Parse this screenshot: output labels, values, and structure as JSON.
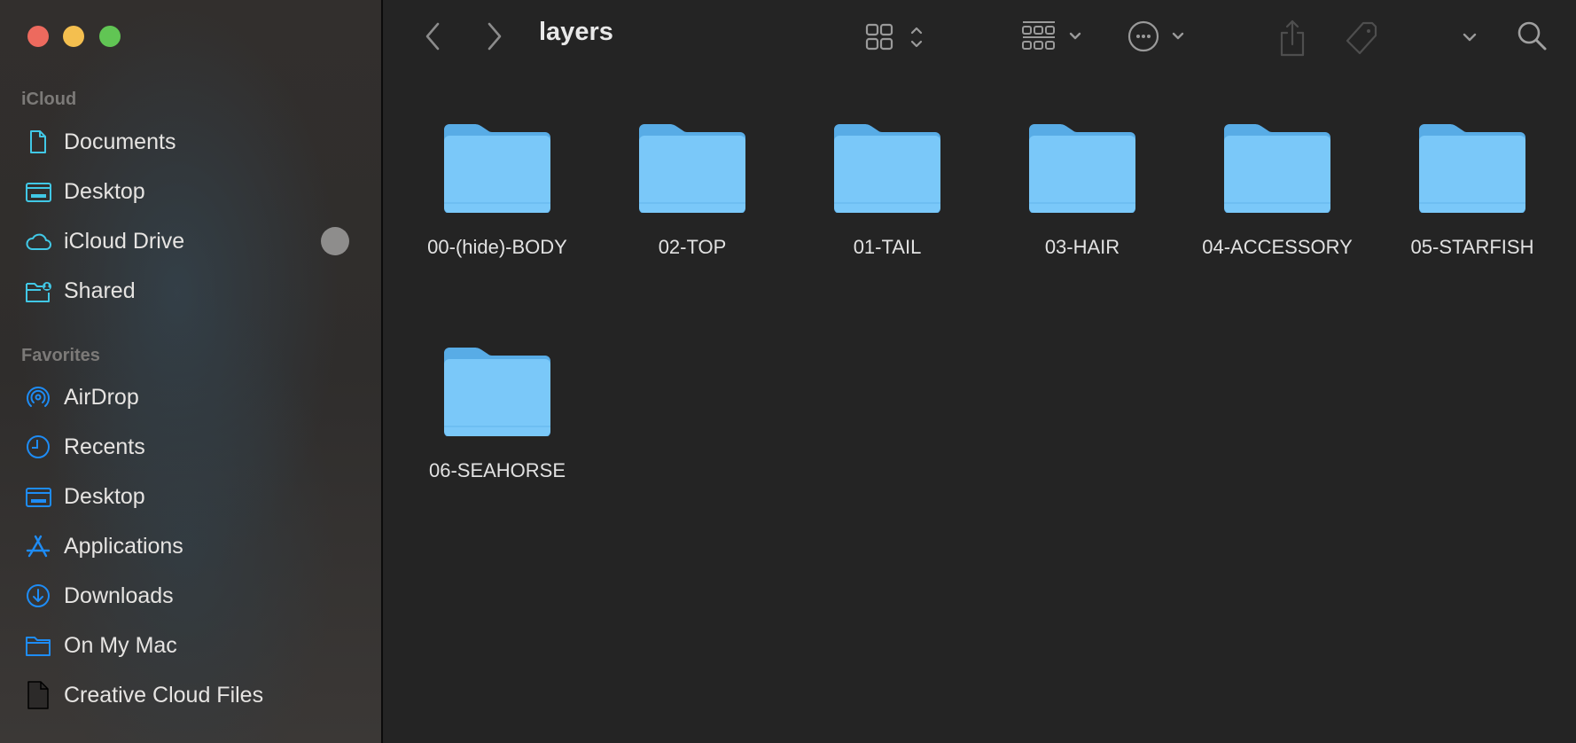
{
  "window": {
    "title": "layers",
    "traffic_lights": [
      "close",
      "minimize",
      "zoom"
    ]
  },
  "toolbar": {
    "back_icon": "chevron-left-icon",
    "forward_icon": "chevron-right-icon",
    "view_icon": "icon-grid-view-icon",
    "group_icon": "group-by-icon",
    "more_icon": "ellipsis-circle-icon",
    "share_icon": "share-icon",
    "tag_icon": "tag-icon",
    "overflow_icon": "chevron-down-icon",
    "search_icon": "search-icon"
  },
  "sidebar": {
    "sections": [
      {
        "title": "iCloud",
        "items": [
          {
            "label": "Documents",
            "icon": "document-icon"
          },
          {
            "label": "Desktop",
            "icon": "desktop-icon"
          },
          {
            "label": "iCloud Drive",
            "icon": "cloud-icon",
            "badge": "sync-progress"
          },
          {
            "label": "Shared",
            "icon": "shared-folder-icon"
          }
        ]
      },
      {
        "title": "Favorites",
        "items": [
          {
            "label": "AirDrop",
            "icon": "airdrop-icon"
          },
          {
            "label": "Recents",
            "icon": "clock-icon"
          },
          {
            "label": "Desktop",
            "icon": "desktop-icon"
          },
          {
            "label": "Applications",
            "icon": "applications-icon"
          },
          {
            "label": "Downloads",
            "icon": "download-icon"
          },
          {
            "label": "On My Mac",
            "icon": "folder-icon"
          },
          {
            "label": "Creative Cloud Files",
            "icon": "blank-document-icon"
          }
        ]
      }
    ]
  },
  "colors": {
    "icloud_icon": "#41c8e6",
    "favorites_icon": "#1e8cf5",
    "folder_back": "#58ace6",
    "folder_front": "#7ac8f9"
  },
  "folders": [
    {
      "name": "00-(hide)-BODY"
    },
    {
      "name": "02-TOP"
    },
    {
      "name": "01-TAIL"
    },
    {
      "name": "03-HAIR"
    },
    {
      "name": "04-ACCESSORY"
    },
    {
      "name": "05-STARFISH"
    },
    {
      "name": "06-SEAHORSE"
    }
  ]
}
